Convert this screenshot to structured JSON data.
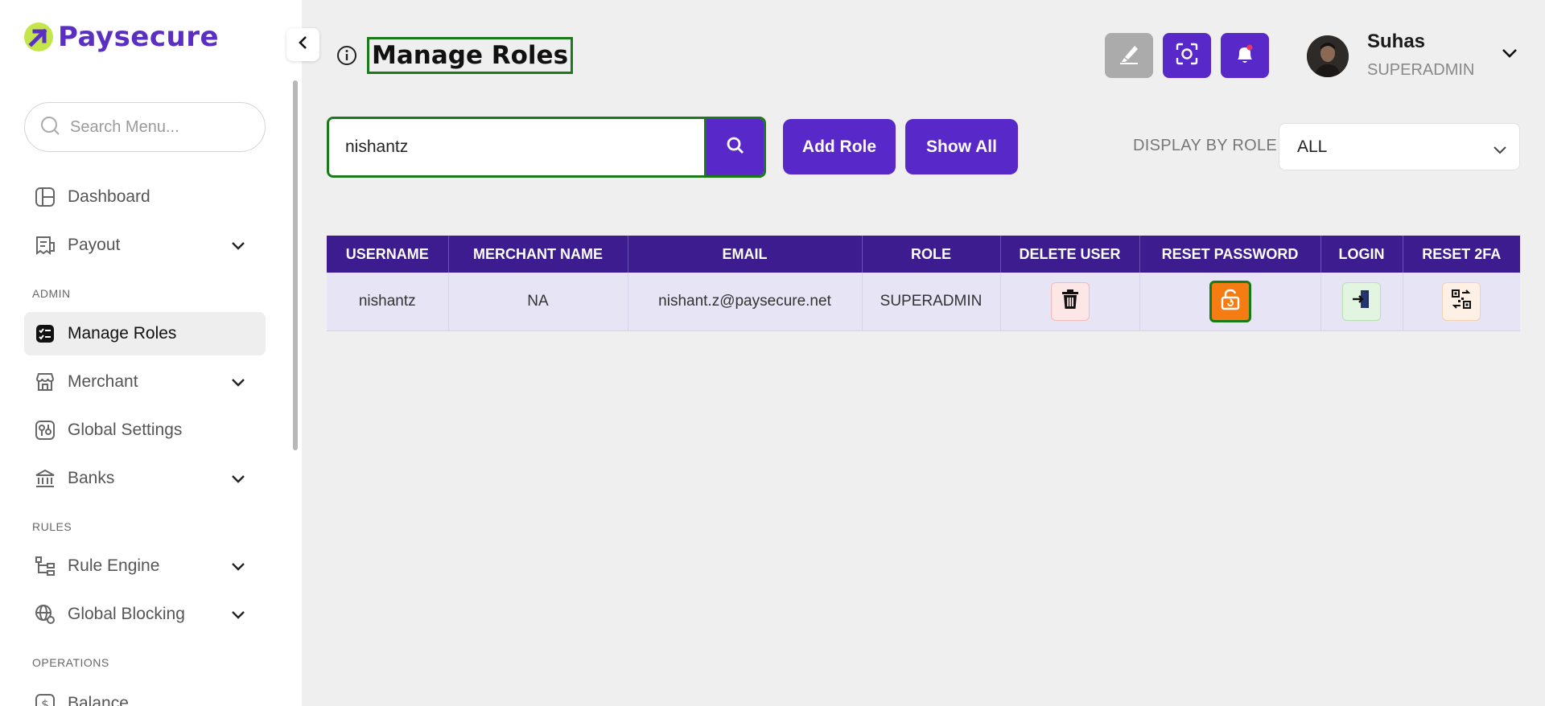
{
  "brand": {
    "name": "Paysecure"
  },
  "sidebar": {
    "search_placeholder": "Search Menu...",
    "items": [
      {
        "label": "Dashboard"
      },
      {
        "label": "Payout"
      },
      {
        "label": "Manage Roles"
      },
      {
        "label": "Merchant"
      },
      {
        "label": "Global Settings"
      },
      {
        "label": "Banks"
      },
      {
        "label": "Rule Engine"
      },
      {
        "label": "Global Blocking"
      },
      {
        "label": "Balance"
      }
    ],
    "sections": {
      "admin": "ADMIN",
      "rules": "RULES",
      "operations": "OPERATIONS"
    }
  },
  "header": {
    "title": "Manage Roles",
    "user": {
      "name": "Suhas",
      "role": "SUPERADMIN"
    }
  },
  "toolbar": {
    "search_value": "nishantz",
    "add_role_label": "Add Role",
    "show_all_label": "Show All",
    "display_by_role_label": "DISPLAY BY ROLE",
    "role_filter_value": "ALL"
  },
  "table": {
    "columns": [
      "USERNAME",
      "MERCHANT NAME",
      "EMAIL",
      "ROLE",
      "DELETE USER",
      "RESET PASSWORD",
      "LOGIN",
      "RESET 2FA"
    ],
    "rows": [
      {
        "username": "nishantz",
        "merchant_name": "NA",
        "email": "nishant.z@paysecure.net",
        "role": "SUPERADMIN"
      }
    ]
  },
  "colors": {
    "accent": "#5828c8",
    "table_header": "#3d1c8f",
    "focus_outline": "#1a7a1a",
    "reset_password": "#f57c12"
  }
}
